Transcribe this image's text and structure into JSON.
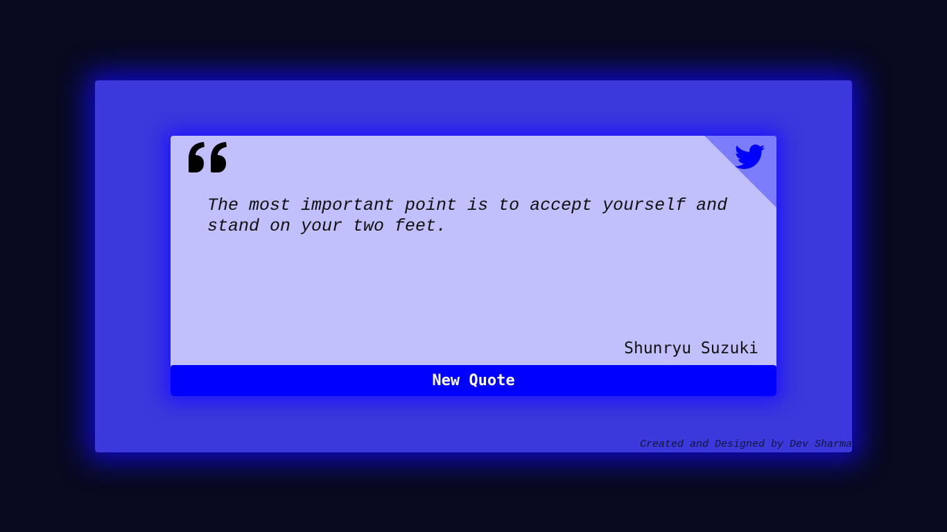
{
  "quote": {
    "text": "The most important point is to accept yourself and stand on your two feet.",
    "author": "Shunryu Suzuki"
  },
  "actions": {
    "new_quote_label": "New Quote"
  },
  "footer": {
    "credit": "Created and Designed by Dev Sharma"
  },
  "icons": {
    "quote": "quote-icon",
    "twitter": "twitter-icon"
  },
  "colors": {
    "page_background": "#080a20",
    "outer_panel": "#3b38dc",
    "card": "#c1bffc",
    "corner_fold": "#7b7dfb",
    "button": "#0000ff",
    "twitter": "#0000ff"
  }
}
